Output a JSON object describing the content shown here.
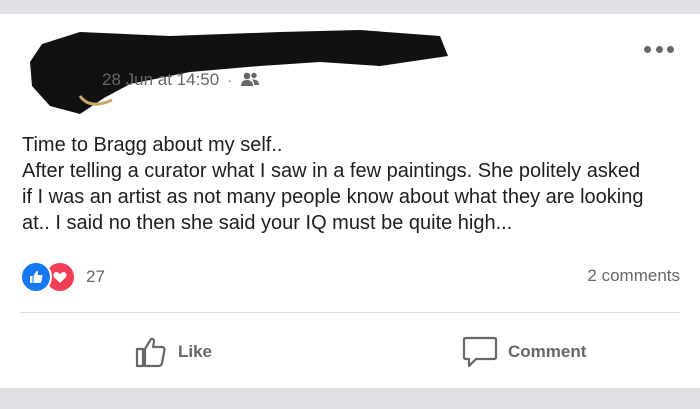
{
  "post": {
    "timestamp": "28 Jun at 14:50",
    "separator": "·",
    "audience_icon": "friends-icon",
    "lines": [
      "Time to Bragg about my self..",
      "After telling a curator what I saw in a few paintings. She politely asked",
      "if I was an artist as not many people know about what they are looking",
      "at..  I said no then she said your IQ must be quite high..."
    ]
  },
  "stats": {
    "reaction_count": "27",
    "comments": "2 comments"
  },
  "actions": {
    "like_label": "Like",
    "comment_label": "Comment"
  },
  "colors": {
    "like_blue": "#1877f2",
    "love_red": "#f33e58",
    "muted_text": "#65676b"
  }
}
